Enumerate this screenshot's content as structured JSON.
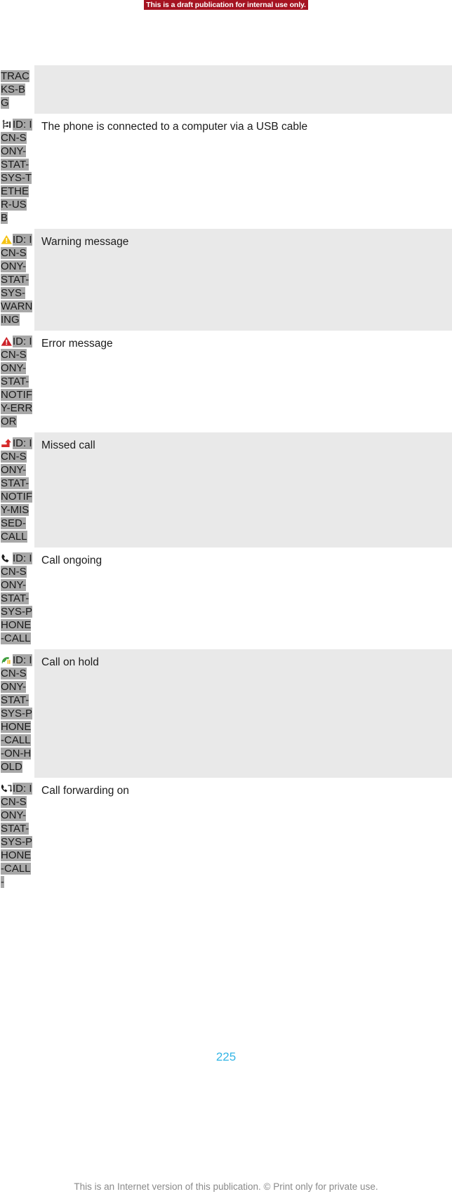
{
  "banner": {
    "text": "This is a draft publication for internal use only."
  },
  "table": {
    "rows": [
      {
        "shaded": true,
        "icon": "none",
        "id_text": "TRACKS-BG",
        "description": ""
      },
      {
        "shaded": false,
        "icon": "usb-icon",
        "id_text": "ID: ICN-SONY-STAT-SYS-TETHER-USB",
        "description": "The phone is connected to a computer via a USB cable"
      },
      {
        "shaded": true,
        "icon": "warning-triangle-icon",
        "id_text": "ID: ICN-SONY-STAT-SYS-WARNING",
        "description": "Warning message"
      },
      {
        "shaded": false,
        "icon": "error-triangle-icon",
        "id_text": "ID: ICN-SONY-STAT-NOTIFY-ERROR",
        "description": "Error message"
      },
      {
        "shaded": true,
        "icon": "missed-call-arrow-icon",
        "id_text": "ID: ICN-SONY-STAT-NOTIFY-MISSED-CALL",
        "description": "Missed call"
      },
      {
        "shaded": false,
        "icon": "phone-handset-icon",
        "id_text": "ID: ICN-SONY-STAT-SYS-PHONE-CALL",
        "description": "Call ongoing"
      },
      {
        "shaded": true,
        "icon": "call-on-hold-icon",
        "id_text": "ID: ICN-SONY-STAT-SYS-PHONE-CALL-ON-HOLD",
        "description": "Call on hold"
      },
      {
        "shaded": false,
        "icon": "call-forwarding-icon",
        "id_text": "ID: ICN-SONY-STAT-SYS-PHONE-CALL-",
        "description": "Call forwarding on"
      }
    ]
  },
  "footer": {
    "page_number": "225",
    "note": "This is an Internet version of this publication. © Print only for private use.",
    "page_number_color": "#33b5e5",
    "note_color": "#8a8a8a",
    "banner_color": "#a51321"
  }
}
